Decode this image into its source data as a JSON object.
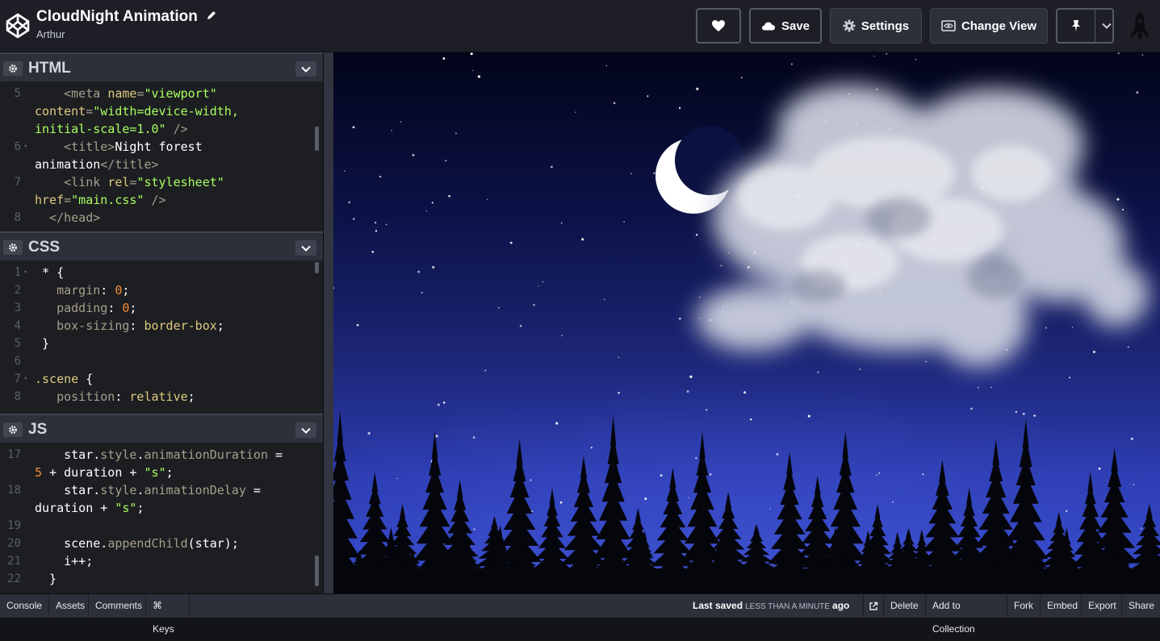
{
  "header": {
    "title": "CloudNight Animation",
    "author": "Arthur",
    "buttons": {
      "save": "Save",
      "settings": "Settings",
      "change_view": "Change View"
    }
  },
  "editors": [
    {
      "name": "HTML",
      "lines": [
        {
          "n": "5",
          "fold": "",
          "parts": [
            [
              "c-tag",
              "    <meta "
            ],
            [
              "c-attr",
              "name"
            ],
            [
              "c-tag",
              "="
            ],
            [
              "c-str",
              "\"viewport\""
            ]
          ]
        },
        {
          "n": "",
          "fold": "",
          "parts": [
            [
              "c-attr",
              "content"
            ],
            [
              "c-tag",
              "="
            ],
            [
              "c-str",
              "\"width=device-width,"
            ]
          ]
        },
        {
          "n": "",
          "fold": "",
          "parts": [
            [
              "c-str",
              "initial-scale=1.0\""
            ],
            [
              "c-tag",
              " />"
            ]
          ]
        },
        {
          "n": "6",
          "fold": "▾",
          "parts": [
            [
              "c-tag",
              "    <title>"
            ],
            [
              "c-txt",
              "Night forest"
            ]
          ]
        },
        {
          "n": "",
          "fold": "",
          "parts": [
            [
              "c-txt",
              "animation"
            ],
            [
              "c-tag",
              "</title>"
            ]
          ]
        },
        {
          "n": "7",
          "fold": "",
          "parts": [
            [
              "c-tag",
              "    <link "
            ],
            [
              "c-attr",
              "rel"
            ],
            [
              "c-tag",
              "="
            ],
            [
              "c-str",
              "\"stylesheet\""
            ]
          ]
        },
        {
          "n": "",
          "fold": "",
          "parts": [
            [
              "c-attr",
              "href"
            ],
            [
              "c-tag",
              "="
            ],
            [
              "c-str",
              "\"main.css\""
            ],
            [
              "c-tag",
              " />"
            ]
          ]
        },
        {
          "n": "8",
          "fold": "",
          "parts": [
            [
              "c-tag",
              "  </head>"
            ]
          ]
        }
      ]
    },
    {
      "name": "CSS",
      "lines": [
        {
          "n": "1",
          "fold": "▾",
          "parts": [
            [
              "c-txt",
              " * {"
            ]
          ]
        },
        {
          "n": "2",
          "fold": "",
          "parts": [
            [
              "c-prop",
              "   margin"
            ],
            [
              "c-txt",
              ": "
            ],
            [
              "c-num",
              "0"
            ],
            [
              "c-txt",
              ";"
            ]
          ]
        },
        {
          "n": "3",
          "fold": "",
          "parts": [
            [
              "c-prop",
              "   padding"
            ],
            [
              "c-txt",
              ": "
            ],
            [
              "c-num",
              "0"
            ],
            [
              "c-txt",
              ";"
            ]
          ]
        },
        {
          "n": "4",
          "fold": "",
          "parts": [
            [
              "c-prop",
              "   box-sizing"
            ],
            [
              "c-txt",
              ": "
            ],
            [
              "c-val",
              "border-box"
            ],
            [
              "c-txt",
              ";"
            ]
          ]
        },
        {
          "n": "5",
          "fold": "",
          "parts": [
            [
              "c-txt",
              " }"
            ]
          ]
        },
        {
          "n": "6",
          "fold": "",
          "parts": []
        },
        {
          "n": "7",
          "fold": "▾",
          "parts": [
            [
              "c-val",
              ".scene"
            ],
            [
              "c-txt",
              " {"
            ]
          ]
        },
        {
          "n": "8",
          "fold": "",
          "parts": [
            [
              "c-prop",
              "   position"
            ],
            [
              "c-txt",
              ": "
            ],
            [
              "c-val",
              "relative"
            ],
            [
              "c-txt",
              ";"
            ]
          ]
        }
      ]
    },
    {
      "name": "JS",
      "lines": [
        {
          "n": "17",
          "fold": "",
          "parts": [
            [
              "c-txt",
              "    star."
            ],
            [
              "c-jsp",
              "style"
            ],
            [
              "c-txt",
              "."
            ],
            [
              "c-jsp",
              "animationDuration"
            ],
            [
              "c-txt",
              " ="
            ]
          ]
        },
        {
          "n": "",
          "fold": "",
          "parts": [
            [
              "c-num",
              "5"
            ],
            [
              "c-txt",
              " + duration + "
            ],
            [
              "c-jss",
              "\"s\""
            ],
            [
              "c-txt",
              ";"
            ]
          ]
        },
        {
          "n": "18",
          "fold": "",
          "parts": [
            [
              "c-txt",
              "    star."
            ],
            [
              "c-jsp",
              "style"
            ],
            [
              "c-txt",
              "."
            ],
            [
              "c-jsp",
              "animationDelay"
            ],
            [
              "c-txt",
              " ="
            ]
          ]
        },
        {
          "n": "",
          "fold": "",
          "parts": [
            [
              "c-txt",
              "duration + "
            ],
            [
              "c-jss",
              "\"s\""
            ],
            [
              "c-txt",
              ";"
            ]
          ]
        },
        {
          "n": "19",
          "fold": "",
          "parts": []
        },
        {
          "n": "20",
          "fold": "",
          "parts": [
            [
              "c-txt",
              "    scene."
            ],
            [
              "c-jsp",
              "appendChild"
            ],
            [
              "c-txt",
              "(star);"
            ]
          ]
        },
        {
          "n": "21",
          "fold": "",
          "parts": [
            [
              "c-txt",
              "    i++;"
            ]
          ]
        },
        {
          "n": "22",
          "fold": "",
          "parts": [
            [
              "c-txt",
              "  }"
            ]
          ]
        }
      ]
    }
  ],
  "footer": {
    "console": "Console",
    "assets": "Assets",
    "comments": "Comments",
    "keys": "⌘ Keys",
    "last_saved_label": "Last saved",
    "last_saved_relative": "LESS THAN A MINUTE",
    "last_saved_suffix": "ago",
    "delete": "Delete",
    "add_to_collection": "Add to Collection",
    "fork": "Fork",
    "embed": "Embed",
    "export": "Export",
    "share": "Share"
  },
  "colors": {
    "accent_bg": "#1e1f26",
    "panel_bg": "#1d1e22",
    "sky_top": "#03051a",
    "sky_bottom": "#3347c8",
    "trees": "#05060c"
  },
  "icons": [
    "codepen-logo-icon",
    "pencil-icon",
    "heart-icon",
    "cloud-icon",
    "gear-icon",
    "view-icon",
    "pin-icon",
    "chevron-down-icon",
    "rocket-icon",
    "external-link-icon",
    "moon-icon"
  ]
}
